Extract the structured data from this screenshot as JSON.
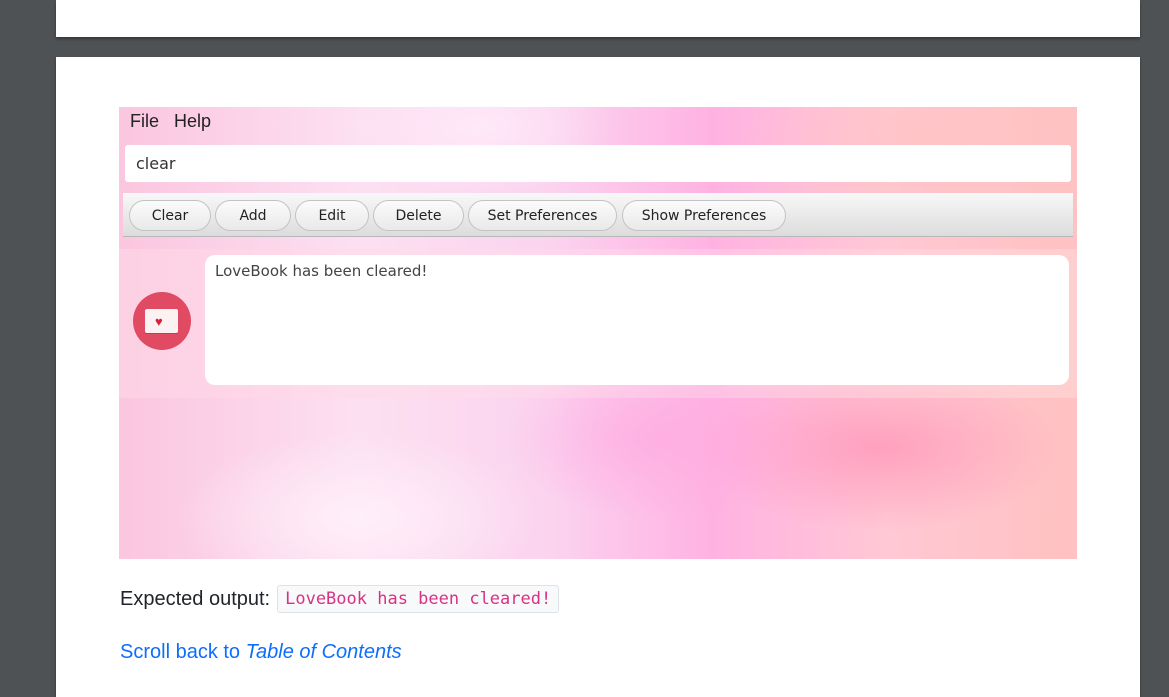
{
  "app": {
    "menu": {
      "file_label": "File",
      "help_label": "Help"
    },
    "command_input": {
      "value": "clear"
    },
    "toolbar": {
      "buttons": [
        "Clear",
        "Add",
        "Edit",
        "Delete",
        "Set Preferences",
        "Show Preferences"
      ]
    },
    "result": {
      "message": "LoveBook has been cleared!",
      "avatar_icon": "love-letter-icon"
    }
  },
  "doc": {
    "expected_label": "Expected output:",
    "expected_code": "LoveBook has been cleared!",
    "back_link_prefix": "Scroll back to",
    "back_link_target": "Table of Contents",
    "link_color": "#0d6efd",
    "code_color": "#d63384"
  }
}
